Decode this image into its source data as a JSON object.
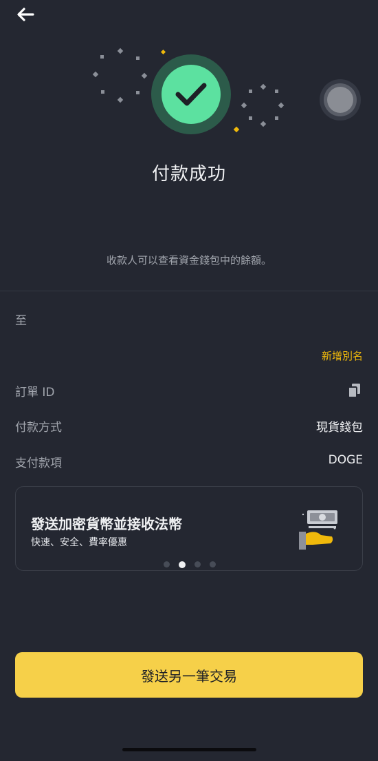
{
  "header": {
    "back_icon": "arrow-left-icon"
  },
  "status": {
    "icon": "check-circle-icon",
    "title": "付款成功",
    "subtitle": "收款人可以查看資金錢包中的餘額。"
  },
  "details": {
    "to_label": "至",
    "add_alias_label": "新增別名",
    "order_id_label": "訂單 ID",
    "order_id_value": "",
    "copy_icon": "copy-icon",
    "payment_method_label": "付款方式",
    "payment_method_value": "現貨錢包",
    "payment_item_label": "支付款項",
    "payment_item_value": "DOGE"
  },
  "promo": {
    "title": "發送加密貨幣並接收法幣",
    "subtitle": "快速、安全、費率優惠",
    "art_icon": "cash-hand-icon",
    "carousel_count": 4,
    "carousel_active": 2
  },
  "actions": {
    "primary_label": "發送另一筆交易"
  },
  "colors": {
    "accent": "#F0B90B",
    "success": "#5CE1A0",
    "button": "#F6D049",
    "background": "#242731"
  }
}
